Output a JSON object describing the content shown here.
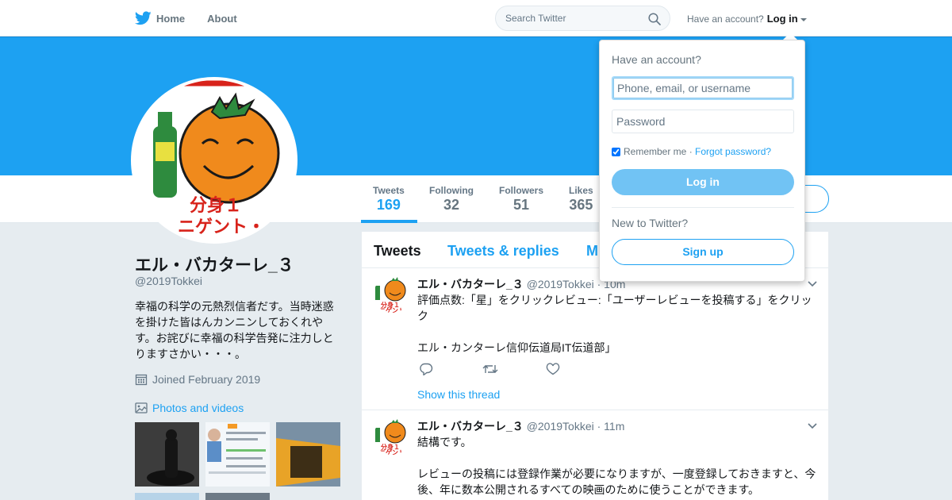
{
  "nav": {
    "home_label": "Home",
    "about_label": "About",
    "search_placeholder": "Search Twitter",
    "account_prompt": "Have an account?",
    "login_label": "Log in"
  },
  "profile": {
    "name": "エル・バカターレ_３",
    "handle": "@2019Tokkei",
    "bio": "幸福の科学の元熱烈信者だす。当時迷惑を掛けた皆はんカンニンしておくれやす。お詫びに幸福の科学告発に注力しとりますさかい・・・。",
    "joined": "Joined February 2019",
    "photos_label": "Photos and videos",
    "avatar_text": "分身１\nニゲント・"
  },
  "stats": [
    {
      "label": "Tweets",
      "value": "169"
    },
    {
      "label": "Following",
      "value": "32"
    },
    {
      "label": "Followers",
      "value": "51"
    },
    {
      "label": "Likes",
      "value": "365"
    }
  ],
  "tabs": [
    "Tweets",
    "Tweets & replies",
    "M"
  ],
  "tweets": [
    {
      "name": "エル・バカターレ_３",
      "handle": "@2019Tokkei",
      "time": "· 10m",
      "text": "評価点数:「星」をクリックレビュー:「ユーザーレビューを投稿する」をクリック\n\nエル・カンターレ信仰伝道局IT伝道部」",
      "thread_link": "Show this thread"
    },
    {
      "name": "エル・バカターレ_３",
      "handle": "@2019Tokkei",
      "time": "· 11m",
      "text": "結構です。\n\nレビューの投稿には登録作業が必要になりますが、一度登録しておきますと、今後、年に数本公開されるすべての映画のために使うことができます。"
    }
  ],
  "login_dropdown": {
    "title": "Have an account?",
    "username_placeholder": "Phone, email, or username",
    "password_placeholder": "Password",
    "remember_label": "Remember me",
    "separator": " · ",
    "forgot_label": "Forgot password?",
    "login_button": "Log in",
    "new_prompt": "New to Twitter?",
    "signup_button": "Sign up"
  },
  "colors": {
    "brand": "#1da1f2",
    "background": "#e6ecf0",
    "text": "#14171a",
    "muted": "#657786"
  }
}
